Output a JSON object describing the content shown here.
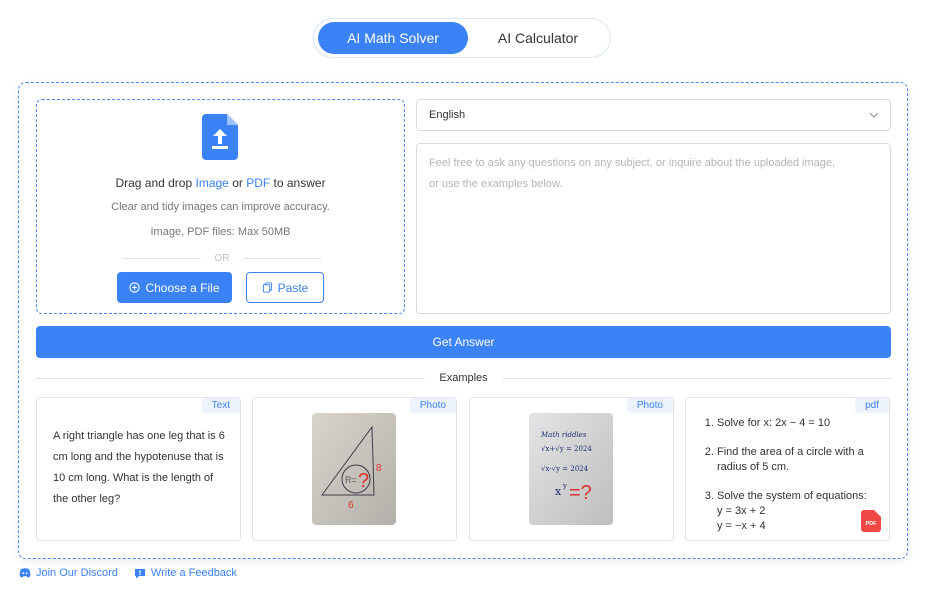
{
  "mode_switch": {
    "active_label": "AI Math Solver",
    "inactive_label": "AI Calculator"
  },
  "upload": {
    "prefix": "Drag and drop ",
    "image_link": "Image",
    "middle": " or ",
    "pdf_link": "PDF",
    "suffix": " to answer",
    "hint": "Clear and tidy images can improve accuracy.",
    "limits": "Image, PDF files: Max 50MB",
    "or": "OR",
    "choose_label": "Choose a File",
    "paste_label": "Paste"
  },
  "language": {
    "selected": "English"
  },
  "question": {
    "placeholder_line1": "Feel free to ask any questions on any subject, or inquire about the uploaded image,",
    "placeholder_line2": "or use the examples below."
  },
  "get_answer_label": "Get Answer",
  "examples_label": "Examples",
  "examples": [
    {
      "tag": "Text",
      "text": "A right triangle has one leg that is 6 cm long and the hypotenuse that is 10 cm long. What is the length of the other leg?"
    },
    {
      "tag": "Photo"
    },
    {
      "tag": "Photo",
      "photo_title": "Math riddles",
      "photo_eq1": "√x+√y = 2024",
      "photo_eq2": "√x-√y = 2024",
      "photo_eq3": "x",
      "photo_eq3_exp": "y",
      "photo_eq3_q": "=?"
    },
    {
      "tag": "pdf",
      "items": [
        "Solve for x: 2x − 4 = 10",
        "Find the area of a circle with a radius of 5 cm.",
        "Solve the system of equations:"
      ],
      "equations": [
        "y = 3x + 2",
        "y = −x + 4"
      ],
      "badge": "PDF"
    }
  ],
  "footer": {
    "discord": "Join Our Discord",
    "feedback": "Write a Feedback"
  },
  "colors": {
    "accent": "#3b82f6",
    "tag_bg": "#edf3fc",
    "pdf_red": "#f04747"
  }
}
